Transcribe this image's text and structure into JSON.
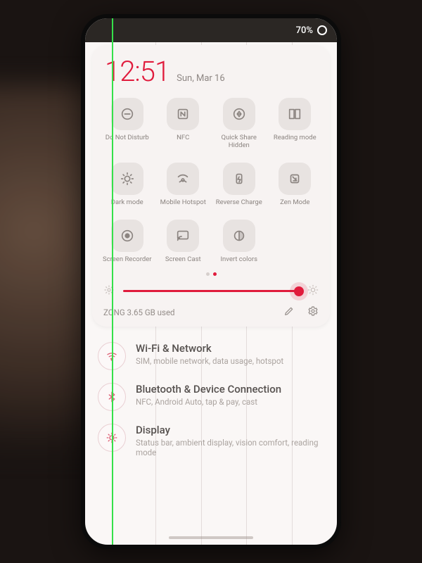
{
  "status": {
    "battery": "70%"
  },
  "clock": {
    "time": "12:51",
    "date": "Sun, Mar 16"
  },
  "tiles": [
    {
      "name": "dnd",
      "label": "Do Not Disturb"
    },
    {
      "name": "nfc",
      "label": "NFC"
    },
    {
      "name": "quick-share",
      "label": "Quick Share\nHidden"
    },
    {
      "name": "reading-mode",
      "label": "Reading mode"
    },
    {
      "name": "dark-mode",
      "label": "Dark mode"
    },
    {
      "name": "mobile-hotspot",
      "label": "Mobile Hotspot"
    },
    {
      "name": "reverse-charge",
      "label": "Reverse Charge"
    },
    {
      "name": "zen-mode",
      "label": "Zen Mode"
    },
    {
      "name": "screen-recorder",
      "label": "Screen Recorder"
    },
    {
      "name": "screen-cast",
      "label": "Screen Cast"
    },
    {
      "name": "invert-colors",
      "label": "Invert colors"
    }
  ],
  "pager": {
    "count": 2,
    "active": 1
  },
  "brightness": {
    "percent": 98
  },
  "footer": {
    "usage": "ZONG  3.65 GB used"
  },
  "settings": [
    {
      "name": "wifi-network",
      "title": "Wi-Fi & Network",
      "sub": "SIM, mobile network, data usage, hotspot"
    },
    {
      "name": "bluetooth",
      "title": "Bluetooth & Device Connection",
      "sub": "NFC, Android Auto, tap & pay, cast"
    },
    {
      "name": "display",
      "title": "Display",
      "sub": "Status bar, ambient display, vision comfort, reading mode"
    }
  ]
}
